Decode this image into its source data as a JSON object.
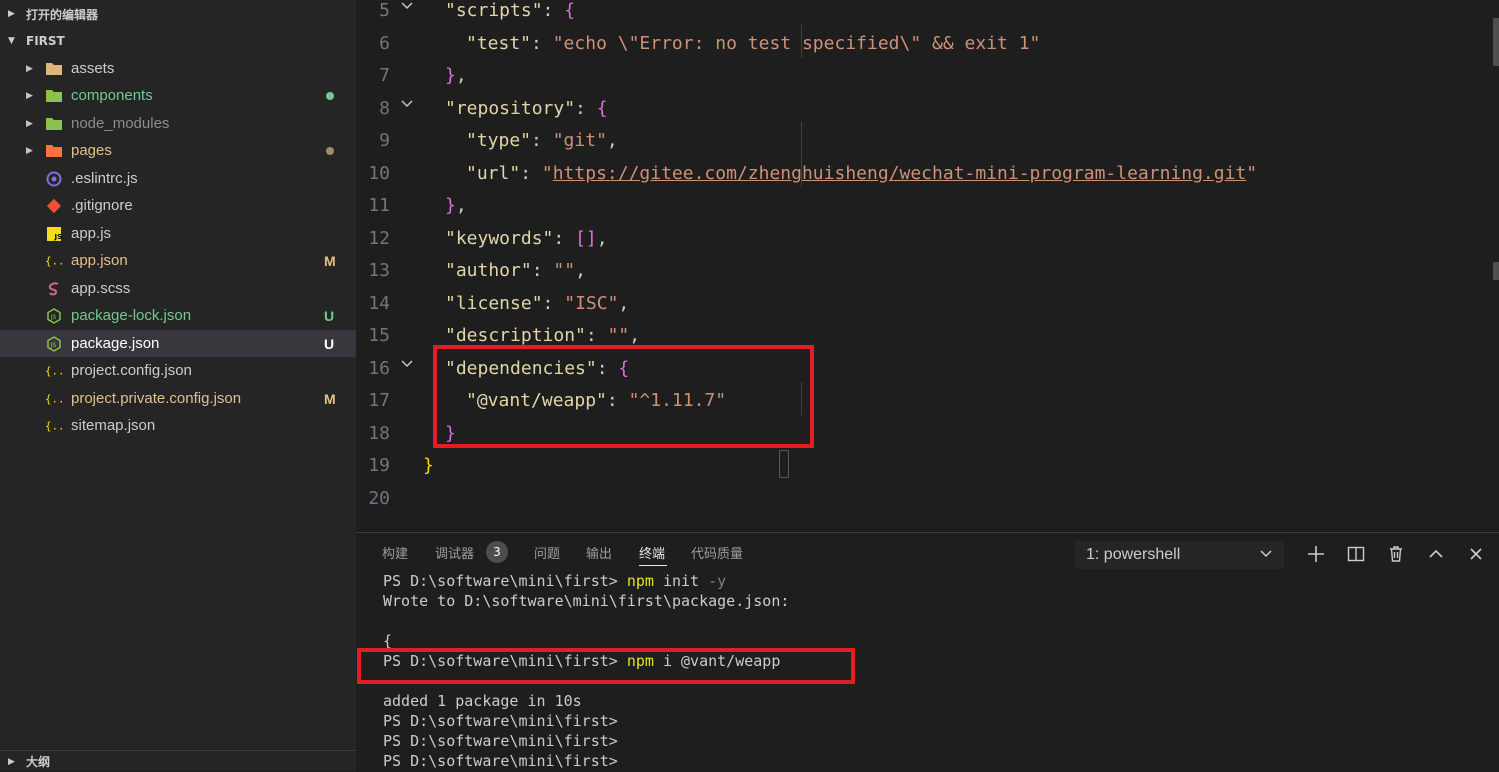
{
  "sidebar": {
    "open_editors_label": "打开的编辑器",
    "project_label": "FIRST",
    "outline_label": "大纲",
    "items": [
      {
        "name": "assets",
        "color": "#cccccc",
        "badge": "",
        "dot": ""
      },
      {
        "name": "components",
        "color": "#73c991",
        "badge": "",
        "dot": "#73c991"
      },
      {
        "name": "node_modules",
        "color": "#8c8c8c",
        "badge": "",
        "dot": ""
      },
      {
        "name": "pages",
        "color": "#e2c08d",
        "badge": "",
        "dot": "#a08c6e"
      },
      {
        "name": ".eslintrc.js",
        "color": "#cccccc",
        "badge": "",
        "dot": ""
      },
      {
        "name": ".gitignore",
        "color": "#cccccc",
        "badge": "",
        "dot": ""
      },
      {
        "name": "app.js",
        "color": "#cccccc",
        "badge": "",
        "dot": ""
      },
      {
        "name": "app.json",
        "color": "#e2c08d",
        "badge": "M",
        "dot": ""
      },
      {
        "name": "app.scss",
        "color": "#cccccc",
        "badge": "",
        "dot": ""
      },
      {
        "name": "package-lock.json",
        "color": "#73c991",
        "badge": "U",
        "dot": ""
      },
      {
        "name": "package.json",
        "color": "#ffffff",
        "badge": "U",
        "dot": ""
      },
      {
        "name": "project.config.json",
        "color": "#cccccc",
        "badge": "",
        "dot": ""
      },
      {
        "name": "project.private.config.json",
        "color": "#e2c08d",
        "badge": "M",
        "dot": ""
      },
      {
        "name": "sitemap.json",
        "color": "#cccccc",
        "badge": "",
        "dot": ""
      }
    ]
  },
  "editor": {
    "line_numbers": [
      "5",
      "6",
      "7",
      "8",
      "9",
      "10",
      "11",
      "12",
      "13",
      "14",
      "15",
      "16",
      "17",
      "18",
      "19",
      "20"
    ],
    "lines": {
      "l5": {
        "key": "\"scripts\"",
        "sep": ": ",
        "open": "{"
      },
      "l6": {
        "key": "\"test\"",
        "sep": ": ",
        "val": "\"echo \\\"Error: no test specified\\\" && exit 1\""
      },
      "l7": {
        "close": "}",
        "tail": ","
      },
      "l8": {
        "key": "\"repository\"",
        "sep": ": ",
        "open": "{"
      },
      "l9": {
        "key": "\"type\"",
        "sep": ": ",
        "val": "\"git\"",
        "tail": ","
      },
      "l10": {
        "key": "\"url\"",
        "sep": ": ",
        "q1": "\"",
        "url": "https://gitee.com/zhenghuisheng/wechat-mini-program-learning.git",
        "q2": "\""
      },
      "l11": {
        "close": "}",
        "tail": ","
      },
      "l12": {
        "key": "\"keywords\"",
        "sep": ": ",
        "val": "[]",
        "tail": ","
      },
      "l13": {
        "key": "\"author\"",
        "sep": ": ",
        "val": "\"\"",
        "tail": ","
      },
      "l14": {
        "key": "\"license\"",
        "sep": ": ",
        "val": "\"ISC\"",
        "tail": ","
      },
      "l15": {
        "key": "\"description\"",
        "sep": ": ",
        "val": "\"\"",
        "tail": ","
      },
      "l16": {
        "key": "\"dependencies\"",
        "sep": ": ",
        "open": "{"
      },
      "l17": {
        "key": "\"@vant/weapp\"",
        "sep": ": ",
        "val": "\"^1.11.7\""
      },
      "l18": {
        "close": "}"
      },
      "l19": {
        "close": "}"
      }
    }
  },
  "panel": {
    "tabs": [
      "构建",
      "调试器",
      "问题",
      "输出",
      "终端",
      "代码质量"
    ],
    "debug_count": "3",
    "terminal_select": "1: powershell",
    "terminal": {
      "t1_prompt": "PS D:\\software\\mini\\first> ",
      "t1_cmd": "npm",
      "t1_arg": " init ",
      "t1_flag": "-y",
      "t2": "Wrote to D:\\software\\mini\\first\\package.json:",
      "t3": "",
      "t4": "{",
      "t5_prompt": "PS D:\\software\\mini\\first> ",
      "t5_cmd": "npm",
      "t5_arg": " i @vant/weapp",
      "t6": "",
      "t7": "added 1 package in 10s",
      "t8": "PS D:\\software\\mini\\first>",
      "t9": "PS D:\\software\\mini\\first>",
      "t10": "PS D:\\software\\mini\\first>"
    }
  },
  "colors": {
    "highlight_box": "#e51c23",
    "accent": "#007acc"
  }
}
